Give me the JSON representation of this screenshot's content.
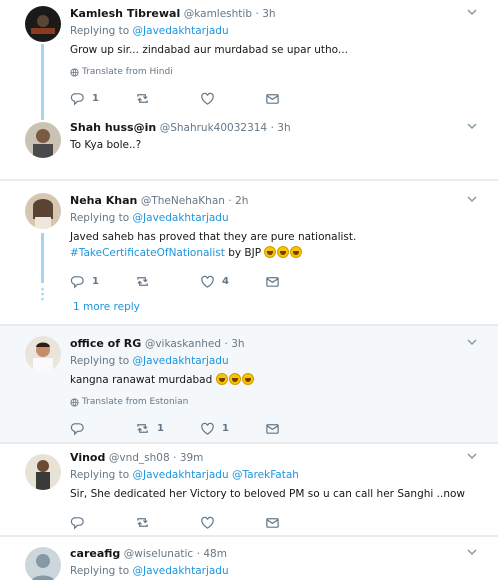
{
  "tweets": [
    {
      "name": "Kamlesh Tibrewal",
      "handle": "@kamleshtib",
      "time": "· 3h",
      "replying_prefix": "Replying to",
      "replying_to": "@Javedakhtarjadu",
      "text": "Grow up sir... zindabad aur murdabad se upar utho...",
      "translate": "Translate from Hindi",
      "reply_count": "1",
      "retweet_count": "",
      "like_count": ""
    },
    {
      "name": "Shah huss@in",
      "handle": "@Shahruk40032314",
      "time": "· 3h",
      "text": "To Kya bole..?",
      "reply_count": "",
      "retweet_count": "",
      "like_count": ""
    },
    {
      "name": "Neha Khan",
      "handle": "@TheNehaKhan",
      "time": "· 2h",
      "replying_prefix": "Replying to",
      "replying_to": "@Javedakhtarjadu",
      "text": "Javed saheb has proved that they are pure nationalist.",
      "hashtag": "#TakeCertificateOfNationalist",
      "text2": "by BJP",
      "reply_count": "1",
      "retweet_count": "",
      "like_count": "4",
      "more_replies": "1 more reply"
    },
    {
      "name": "office of RG",
      "handle": "@vikaskanhed",
      "time": "· 3h",
      "replying_prefix": "Replying to",
      "replying_to": "@Javedakhtarjadu",
      "text": "kangna ranawat murdabad",
      "translate": "Translate from Estonian",
      "reply_count": "",
      "retweet_count": "1",
      "like_count": "1"
    },
    {
      "name": "Vinod",
      "handle": "@vnd_sh08",
      "time": "· 39m",
      "replying_prefix": "Replying to",
      "replying_to": "@Javedakhtarjadu",
      "replying_to2": "@TarekFatah",
      "text": "Sir, She dedicated her Victory to beloved PM so u can call her Sanghi ..now",
      "reply_count": "",
      "retweet_count": "",
      "like_count": ""
    },
    {
      "name": "careafig",
      "handle": "@wiselunatic",
      "time": "· 48m",
      "replying_prefix": "Replying to",
      "replying_to": "@Javedakhtarjadu"
    }
  ],
  "colors": {
    "link": "#1b95e0",
    "muted": "#657786",
    "thread": "#a3d4f2"
  }
}
